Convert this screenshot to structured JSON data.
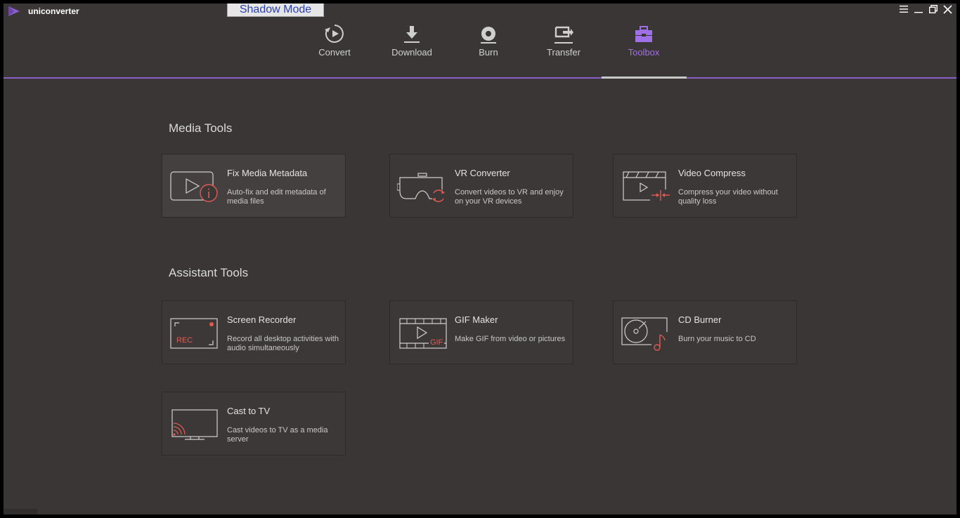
{
  "app": {
    "title": "uniconverter",
    "shadow_badge": "Shadow Mode",
    "colors": {
      "accent": "#a070e6",
      "tool_red": "#e05a52",
      "bg": "#3a3636"
    }
  },
  "window_controls": [
    {
      "icon": "menu-icon"
    },
    {
      "icon": "minimize-icon"
    },
    {
      "icon": "restore-icon"
    },
    {
      "icon": "close-icon"
    }
  ],
  "nav": {
    "items": [
      {
        "label": "Convert",
        "icon": "convert-icon",
        "active": false
      },
      {
        "label": "Download",
        "icon": "download-icon",
        "active": false
      },
      {
        "label": "Burn",
        "icon": "burn-icon",
        "active": false
      },
      {
        "label": "Transfer",
        "icon": "transfer-icon",
        "active": false
      },
      {
        "label": "Toolbox",
        "icon": "toolbox-icon",
        "active": true
      }
    ]
  },
  "sections": {
    "media": {
      "title": "Media Tools",
      "cards": [
        {
          "title": "Fix Media Metadata",
          "desc": "Auto-fix and edit metadata of media files",
          "icon": "metadata-icon"
        },
        {
          "title": "VR Converter",
          "desc": "Convert videos to VR and enjoy on your VR devices",
          "icon": "vr-icon"
        },
        {
          "title": "Video Compress",
          "desc": "Compress your video without quality loss",
          "icon": "compress-icon"
        }
      ]
    },
    "assistant": {
      "title": "Assistant Tools",
      "cards": [
        {
          "title": "Screen Recorder",
          "desc": "Record all desktop activities with audio simultaneously",
          "icon": "screen-recorder-icon",
          "badge": "REC"
        },
        {
          "title": "GIF Maker",
          "desc": "Make GIF from video or pictures",
          "icon": "gif-icon",
          "badge": "GIF"
        },
        {
          "title": "CD Burner",
          "desc": "Burn your music to CD",
          "icon": "cd-burner-icon"
        },
        {
          "title": "Cast to TV",
          "desc": "Cast videos to TV as a media server",
          "icon": "cast-tv-icon"
        }
      ]
    }
  }
}
